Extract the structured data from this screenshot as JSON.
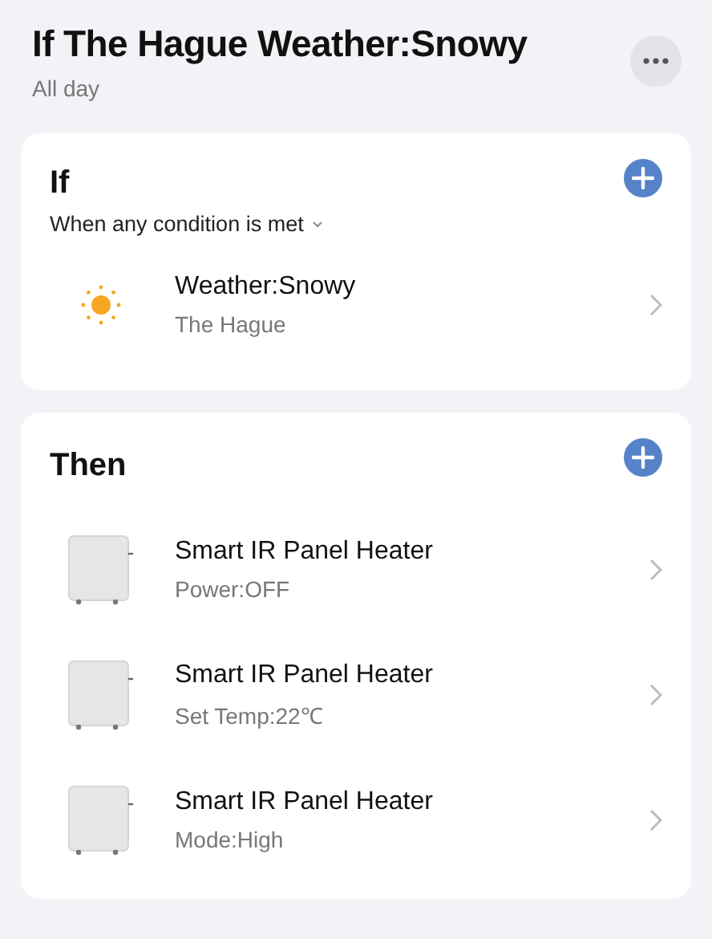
{
  "header": {
    "title": "If The Hague Weather:Snowy",
    "subtitle": "All day"
  },
  "if_section": {
    "title": "If",
    "condition_mode": "When any condition is met",
    "items": [
      {
        "kind": "weather",
        "title": "Weather:Snowy",
        "subtitle": "The Hague"
      }
    ]
  },
  "then_section": {
    "title": "Then",
    "items": [
      {
        "kind": "device",
        "title": "Smart IR Panel Heater",
        "subtitle": "Power:OFF"
      },
      {
        "kind": "device",
        "title": "Smart IR Panel Heater",
        "subtitle": "Set Temp:22℃"
      },
      {
        "kind": "device",
        "title": "Smart IR Panel Heater",
        "subtitle": "Mode:High"
      }
    ]
  }
}
